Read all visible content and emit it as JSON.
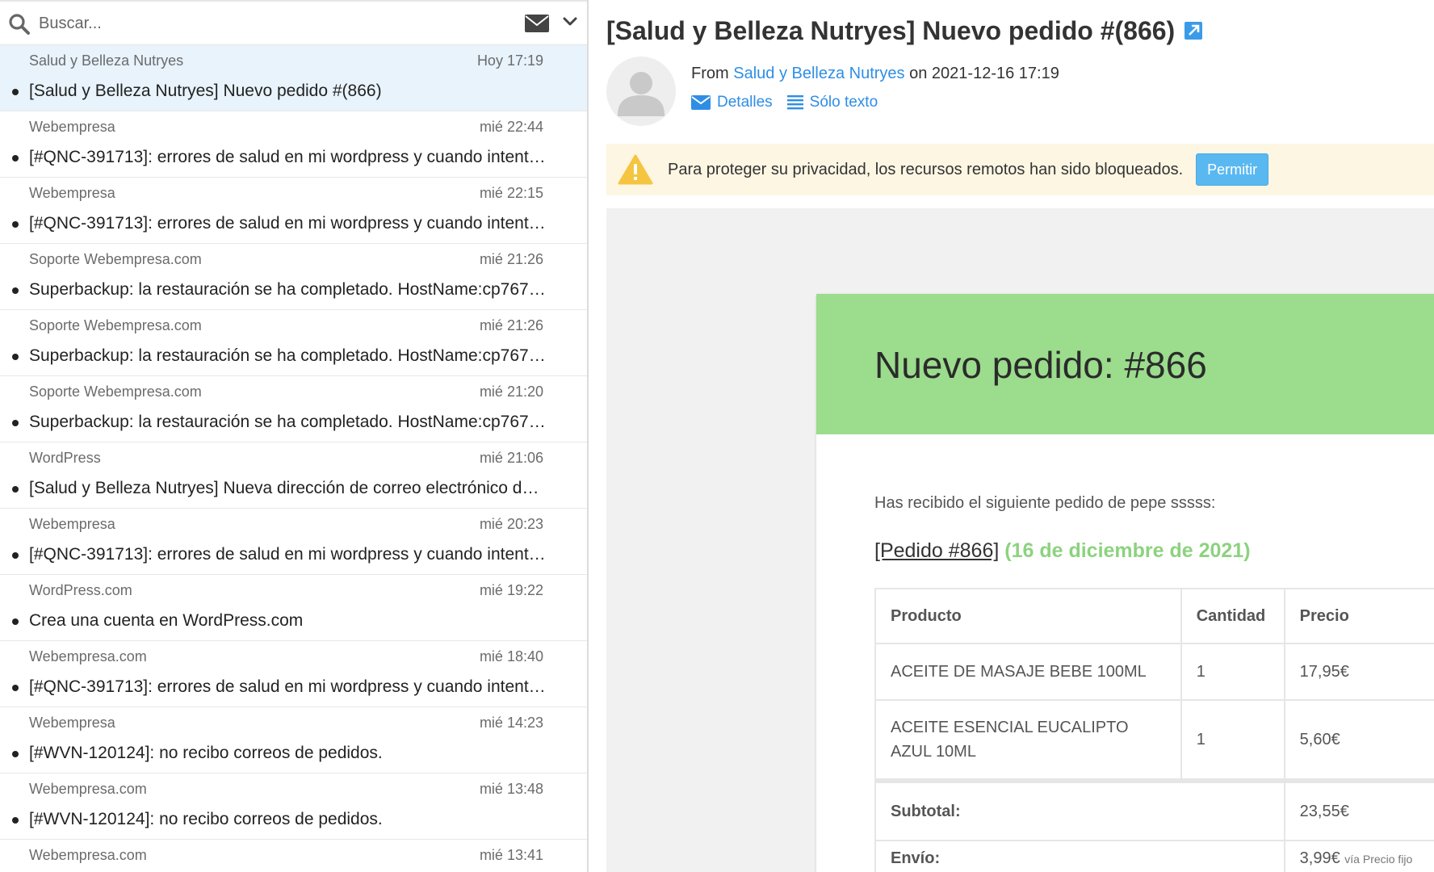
{
  "search": {
    "placeholder": "Buscar..."
  },
  "messages": [
    {
      "from": "Salud y Belleza Nutryes",
      "date": "Hoy 17:19",
      "subject": "[Salud y Belleza Nutryes] Nuevo pedido #(866)",
      "selected": true
    },
    {
      "from": "Webempresa",
      "date": "mié 22:44",
      "subject": "[#QNC-391713]: errores de salud en mi wordpress y cuando intent…"
    },
    {
      "from": "Webempresa",
      "date": "mié 22:15",
      "subject": "[#QNC-391713]: errores de salud en mi wordpress y cuando intent…"
    },
    {
      "from": "Soporte Webempresa.com",
      "date": "mié 21:26",
      "subject": "Superbackup: la restauración se ha completado. HostName:cp767…"
    },
    {
      "from": "Soporte Webempresa.com",
      "date": "mié 21:26",
      "subject": "Superbackup: la restauración se ha completado. HostName:cp767…"
    },
    {
      "from": "Soporte Webempresa.com",
      "date": "mié 21:20",
      "subject": "Superbackup: la restauración se ha completado. HostName:cp767…"
    },
    {
      "from": "WordPress",
      "date": "mié 21:06",
      "subject": "[Salud y Belleza Nutryes] Nueva dirección de correo electrónico de …"
    },
    {
      "from": "Webempresa",
      "date": "mié 20:23",
      "subject": "[#QNC-391713]: errores de salud en mi wordpress y cuando intent…"
    },
    {
      "from": "WordPress.com",
      "date": "mié 19:22",
      "subject": "Crea una cuenta en WordPress.com"
    },
    {
      "from": "Webempresa.com",
      "date": "mié 18:40",
      "subject": "[#QNC-391713]: errores de salud en mi wordpress y cuando intent…"
    },
    {
      "from": "Webempresa",
      "date": "mié 14:23",
      "subject": "[#WVN-120124]: no recibo correos de pedidos."
    },
    {
      "from": "Webempresa.com",
      "date": "mié 13:48",
      "subject": "[#WVN-120124]: no recibo correos de pedidos."
    },
    {
      "from": "Webempresa.com",
      "date": "mié 13:41",
      "subject": ""
    }
  ],
  "preview": {
    "subject": "[Salud y Belleza Nutryes] Nuevo pedido #(866)",
    "from_prefix": "From",
    "sender": "Salud y Belleza Nutryes",
    "date_text": "on 2021-12-16 17:19",
    "details_label": "Detalles",
    "plain_label": "Sólo texto",
    "privacy_text": "Para proteger su privacidad, los recursos remotos han sido bloqueados.",
    "allow_label": "Permitir",
    "colors": {
      "link": "#2e8ee6",
      "banner": "#9bdc8d",
      "date_green": "#8dd27f",
      "warning_bg": "#fdf6e3"
    }
  },
  "email": {
    "banner_title": "Nuevo pedido: #866",
    "intro": "Has recibido el siguiente pedido de pepe sssss:",
    "order_link": "[Pedido #866]",
    "order_date": "(16 de diciembre de 2021)",
    "table": {
      "headers": [
        "Producto",
        "Cantidad",
        "Precio"
      ],
      "rows": [
        [
          "ACEITE DE MASAJE BEBE 100ML",
          "1",
          "17,95€"
        ],
        [
          "ACEITE ESENCIAL EUCALIPTO AZUL 10ML",
          "1",
          "5,60€"
        ]
      ],
      "subtotal_label": "Subtotal:",
      "subtotal_value": "23,55€",
      "shipping_label": "Envío:",
      "shipping_value": "3,99€",
      "shipping_via": "vía Precio fijo"
    }
  }
}
